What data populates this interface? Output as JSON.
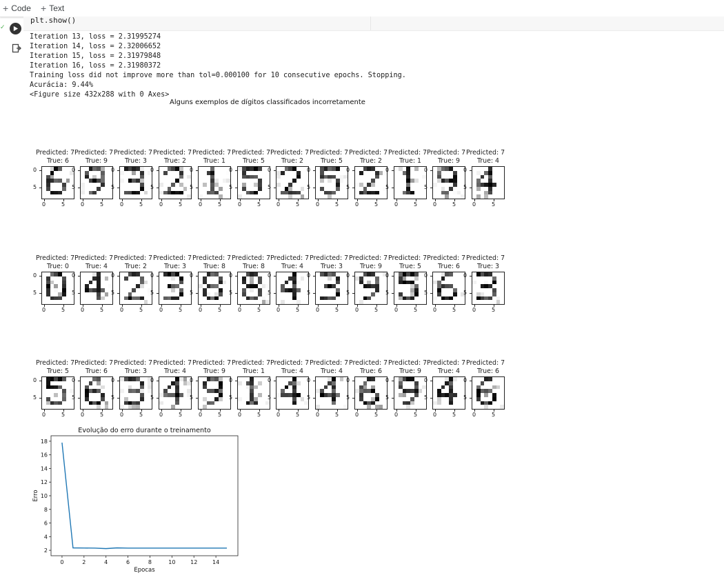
{
  "toolbar": {
    "code_label": "Code",
    "text_label": "Text"
  },
  "cell": {
    "code": "plt.show()"
  },
  "output": {
    "lines": [
      "Iteration 13, loss = 2.31995274",
      "Iteration 14, loss = 2.32006652",
      "Iteration 15, loss = 2.31979848",
      "Iteration 16, loss = 2.31980372",
      "Training loss did not improve more than tol=0.000100 for 10 consecutive epochs. Stopping.",
      "Acurácia: 9.44%",
      "<Figure size 432x288 with 0 Axes>"
    ]
  },
  "figure": {
    "suptitle": "Alguns exemplos de dígitos classificados incorretamente",
    "predicted_label": "Predicted: 7",
    "ytick_labels": [
      "0",
      "5"
    ],
    "xtick_labels": [
      "0",
      "5"
    ],
    "rows": [
      [
        "True: 6",
        "True: 9",
        "True: 3",
        "True: 2",
        "True: 1",
        "True: 5",
        "True: 2",
        "True: 5",
        "True: 2",
        "True: 1",
        "True: 9",
        "True: 4"
      ],
      [
        "True: 0",
        "True: 4",
        "True: 2",
        "True: 3",
        "True: 8",
        "True: 8",
        "True: 4",
        "True: 3",
        "True: 9",
        "True: 5",
        "True: 6",
        "True: 3"
      ],
      [
        "True: 5",
        "True: 6",
        "True: 3",
        "True: 4",
        "True: 9",
        "True: 1",
        "True: 4",
        "True: 4",
        "True: 6",
        "True: 9",
        "True: 4",
        "True: 6"
      ]
    ]
  },
  "colors": {
    "line": "#1f77b4",
    "toolbar_border": "#e0e0e0"
  },
  "chart_data": {
    "type": "line",
    "title": "Evolução do erro durante o treinamento",
    "xlabel": "Epocas",
    "ylabel": "Erro",
    "x": [
      0,
      1,
      2,
      3,
      4,
      5,
      6,
      7,
      8,
      9,
      10,
      11,
      12,
      13,
      14,
      15
    ],
    "values": [
      17.8,
      2.35,
      2.33,
      2.32,
      2.25,
      2.35,
      2.32,
      2.32,
      2.32,
      2.32,
      2.32,
      2.32,
      2.32,
      2.32,
      2.32,
      2.32
    ],
    "xticks": [
      0,
      2,
      4,
      6,
      8,
      10,
      12,
      14
    ],
    "yticks": [
      2,
      4,
      6,
      8,
      10,
      12,
      14,
      16,
      18
    ],
    "xlim": [
      -1,
      16
    ],
    "ylim": [
      1.2,
      18.8
    ]
  }
}
